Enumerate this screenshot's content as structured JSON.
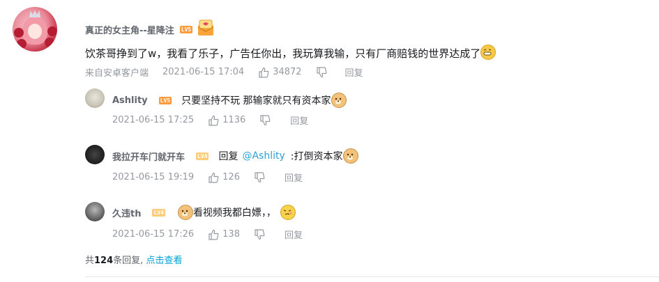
{
  "main_comment": {
    "username": "真正的女主角--星降注",
    "level": "LV5",
    "text": "饮茶哥挣到了w，我看了乐子，广告任你出，我玩算我输，只有厂商赔钱的世界达成了",
    "source": "来自安卓客户端",
    "time": "2021-06-15 17:04",
    "likes": "34872",
    "reply_label": "回复"
  },
  "replies": [
    {
      "username": "Ashlity",
      "level": "LV5",
      "text": "只要坚持不玩  那输家就只有资本家",
      "time": "2021-06-15 17:25",
      "likes": "1136",
      "reply_label": "回复"
    },
    {
      "username": "我拉开车门就开车",
      "level": "LV4",
      "reply_prefix": "回复",
      "mention": "@Ashlity",
      "text": ":打倒资本家",
      "time": "2021-06-15 19:19",
      "likes": "126",
      "reply_label": "回复"
    },
    {
      "username": "久违th",
      "level": "LV4",
      "text": "看视频我都白嫖，，",
      "time": "2021-06-15 17:26",
      "likes": "138",
      "reply_label": "回复"
    }
  ],
  "footer": {
    "prefix": "共",
    "count": "124",
    "suffix": "条回复,",
    "view_link": "点击查看"
  },
  "icons": {
    "like": "thumbs-up-icon",
    "dislike": "thumbs-down-icon",
    "gift": "gift-icon",
    "emoji_laugh": "laughing-emoji",
    "emoji_doge": "doge-emoji",
    "emoji_smirk": "smirk-emoji"
  },
  "colors": {
    "level5": "#ff9a3d",
    "level4": "#ffcc7a",
    "link": "#2ea0d6",
    "meta": "#9499a0"
  }
}
